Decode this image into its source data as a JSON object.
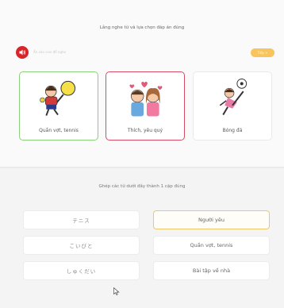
{
  "listen": {
    "instruction": "Lắng nghe từ và lựa chọn đáp án đúng",
    "audio_hint": "Ấn vào icon để nghe",
    "next_label": "Tiếp >",
    "choices": [
      {
        "caption": "Quần vợt, tennis",
        "image": "tennis-player-image",
        "state": "correct"
      },
      {
        "caption": "Thích, yêu quý",
        "image": "couple-image",
        "state": "wrong"
      },
      {
        "caption": "Bóng đá",
        "image": "soccer-player-image",
        "state": "default"
      }
    ]
  },
  "match": {
    "instruction": "Ghép các từ dưới đây thành 1 cặp đúng",
    "left": [
      "テニス",
      "こいびと",
      "しゅくだい"
    ],
    "right": [
      "Người yêu",
      "Quần vợt, tennis",
      "Bài tập về nhà"
    ]
  },
  "colors": {
    "accent_red": "#d7252b",
    "correct_green": "#8bd07a",
    "wrong_red": "#d94a63",
    "selected_yellow": "#f2c66a"
  }
}
